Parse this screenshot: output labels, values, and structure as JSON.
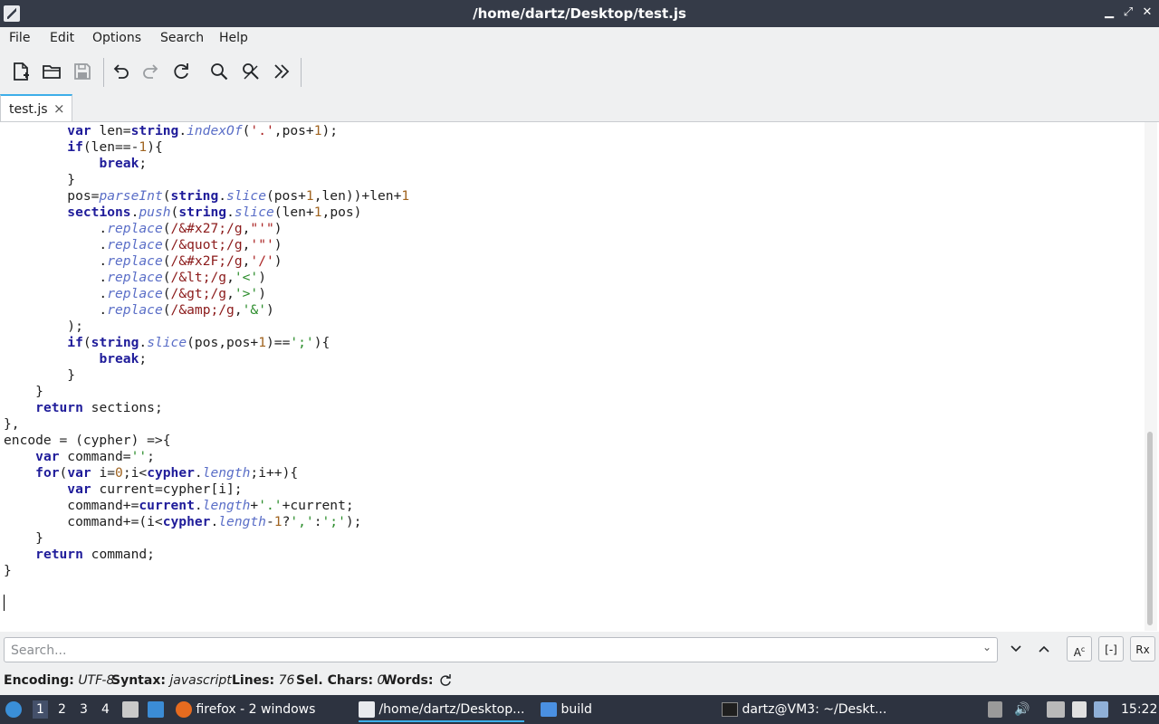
{
  "window": {
    "title": "/home/dartz/Desktop/test.js",
    "min": "▁",
    "max": "⤢",
    "close": "✕"
  },
  "menu": [
    "File",
    "Edit",
    "Options",
    "Search",
    "Help"
  ],
  "tab": {
    "label": "test.js",
    "close": "×"
  },
  "editor": {
    "lines": [
      "        <k>var</k> len=<k>string</k>.<f>indexOf</f>(<s>'.'</s>,pos+<n>1</n>);",
      "        <k>if</k>(len==-<n>1</n>){",
      "            <k>break</k>;",
      "        }",
      "        pos=<f>parseInt</f>(<k>string</k>.<f>slice</f>(pos+<n>1</n>,len))+len+<n>1</n>",
      "        <k>sections</k>.<f>push</f>(<k>string</k>.<f>slice</f>(len+<n>1</n>,pos)",
      "            .<f>replace</f>(<r>/&amp;#x27;/g</r>,<s>\"'\"</s>)",
      "            .<f>replace</f>(<r>/&amp;quot;/g</r>,<s>'\"'</s>)",
      "            .<f>replace</f>(<r>/&amp;#x2F;/g</r>,<s>'/'</s>)",
      "            .<f>replace</f>(<r>/&amp;lt;/g</r>,<g>'&lt;'</g>)",
      "            .<f>replace</f>(<r>/&amp;gt;/g</r>,<g>'&gt;'</g>)",
      "            .<f>replace</f>(<r>/&amp;amp;/g</r>,<g>'&amp;'</g>)",
      "        );",
      "        <k>if</k>(<k>string</k>.<f>slice</f>(pos,pos+<n>1</n>)==<g>';'</g>){",
      "            <k>break</k>;",
      "        }",
      "    }",
      "    <k>return</k> sections;",
      "},",
      "encode = (cypher) =>{",
      "    <k>var</k> command=<g>''</g>;",
      "    <k>for</k>(<k>var</k> i=<n>0</n>;i&lt;<k>cypher</k>.<f2>length</f2>;i++){",
      "        <k>var</k> current=cypher[i];",
      "        command+=<k>current</k>.<f2>length</f2>+<g>'.'</g>+current;",
      "        command+=(i&lt;<k>cypher</k>.<f2>length</f2>-<n>1</n>?<g>','</g>:<g>';'</g>);",
      "    }",
      "    <k>return</k> command;",
      "}",
      "",
      ""
    ]
  },
  "search": {
    "placeholder": "Search..."
  },
  "status": {
    "encoding_label": "Encoding:",
    "encoding": "UTF-8",
    "syntax_label": "Syntax:",
    "syntax": "javascript",
    "lines_label": "Lines:",
    "lines": "76",
    "sel_label": "Sel. Chars:",
    "sel": "0",
    "words_label": "Words:"
  },
  "taskbar": {
    "workspaces": [
      "1",
      "2",
      "3",
      "4"
    ],
    "firefox": "firefox - 2 windows",
    "editor": "/home/dartz/Desktop...",
    "build": "build",
    "terminal": "dartz@VM3: ~/Deskt...",
    "clock": "15:22"
  },
  "icons": [
    "new-file-icon",
    "open-folder-icon",
    "save-icon",
    "undo-icon",
    "redo-icon",
    "reload-icon",
    "find-icon",
    "find-replace-icon",
    "go-more-icon"
  ]
}
